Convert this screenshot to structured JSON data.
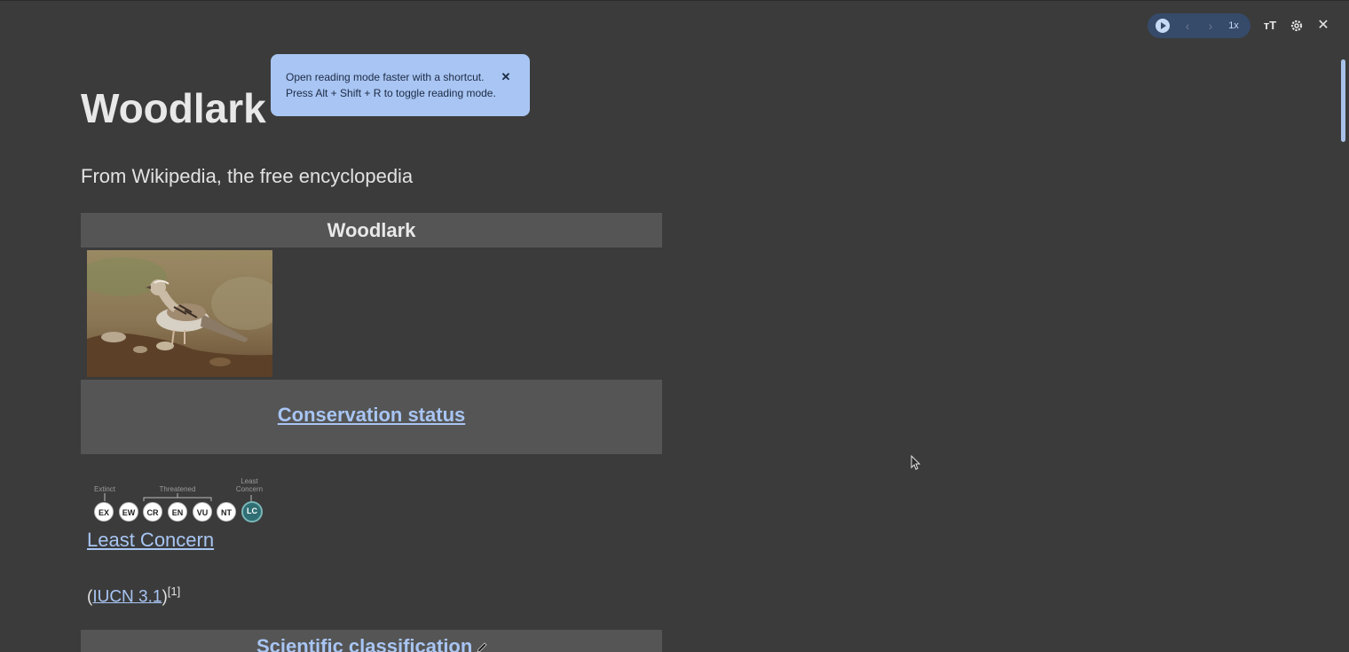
{
  "toolbar": {
    "play_icon": "play-icon",
    "prev_label": "‹",
    "next_label": "›",
    "speed_label": "1x",
    "font_size_label": "ᴛT",
    "close_label": "✕"
  },
  "tooltip": {
    "text_line1": "Open reading mode faster with a shortcut.",
    "text_line2": "Press Alt + Shift + R to toggle reading mode.",
    "close_label": "✕"
  },
  "article": {
    "title": "Woodlark",
    "subtitle": "From Wikipedia, the free encyclopedia",
    "infobox": {
      "header": "Woodlark",
      "conservation_link": "Conservation status",
      "scale": {
        "group_labels": [
          "Extinct",
          "Threatened",
          "Least Concern"
        ],
        "categories": [
          "EX",
          "EW",
          "CR",
          "EN",
          "VU",
          "NT",
          "LC"
        ],
        "selected": "LC"
      },
      "status_link": "Least Concern",
      "iucn_open": "(",
      "iucn_link": "IUCN 3.1",
      "iucn_close": ")",
      "iucn_ref": "[1]",
      "classification_link": "Scientific classification"
    }
  },
  "colors": {
    "background": "#3b3b3b",
    "band": "#555555",
    "link": "#a8c5f3",
    "tooltip": "#a8c5f3",
    "player": "#364a6a",
    "lc_circle": "#2f6e73"
  }
}
